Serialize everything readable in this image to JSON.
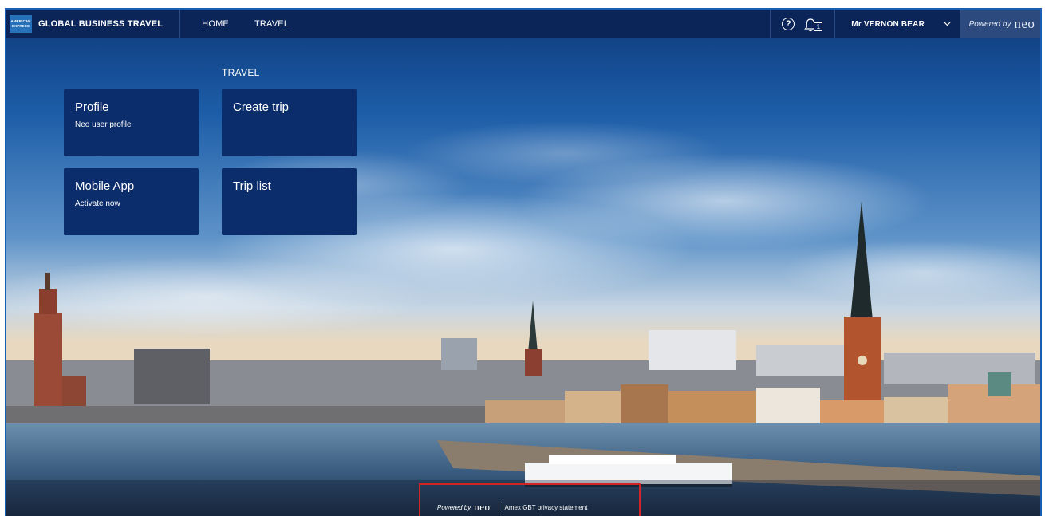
{
  "header": {
    "logo_line1": "AMERICAN",
    "logo_line2": "EXPRESS",
    "brand": "GLOBAL BUSINESS TRAVEL",
    "nav": [
      {
        "label": "HOME"
      },
      {
        "label": "TRAVEL"
      }
    ],
    "help_icon": "question-circle-icon",
    "notification_count": "1",
    "user_name": "Mr VERNON BEAR",
    "powered_by": "Powered by",
    "powered_brand": "neo"
  },
  "tiles": {
    "section_label": "TRAVEL",
    "profile": {
      "title": "Profile",
      "subtitle": "Neo user profile"
    },
    "mobile_app": {
      "title": "Mobile App",
      "subtitle": "Activate now"
    },
    "create_trip": {
      "title": "Create trip"
    },
    "trip_list": {
      "title": "Trip list"
    }
  },
  "footer": {
    "powered_by": "Powered by",
    "powered_brand": "neo",
    "privacy_link": "Amex GBT privacy statement"
  },
  "colors": {
    "header_bg": "#0b2559",
    "tile_bg": "#0c2d6c",
    "powered_box_bg": "#2d4a7f",
    "highlight": "#d32424"
  }
}
